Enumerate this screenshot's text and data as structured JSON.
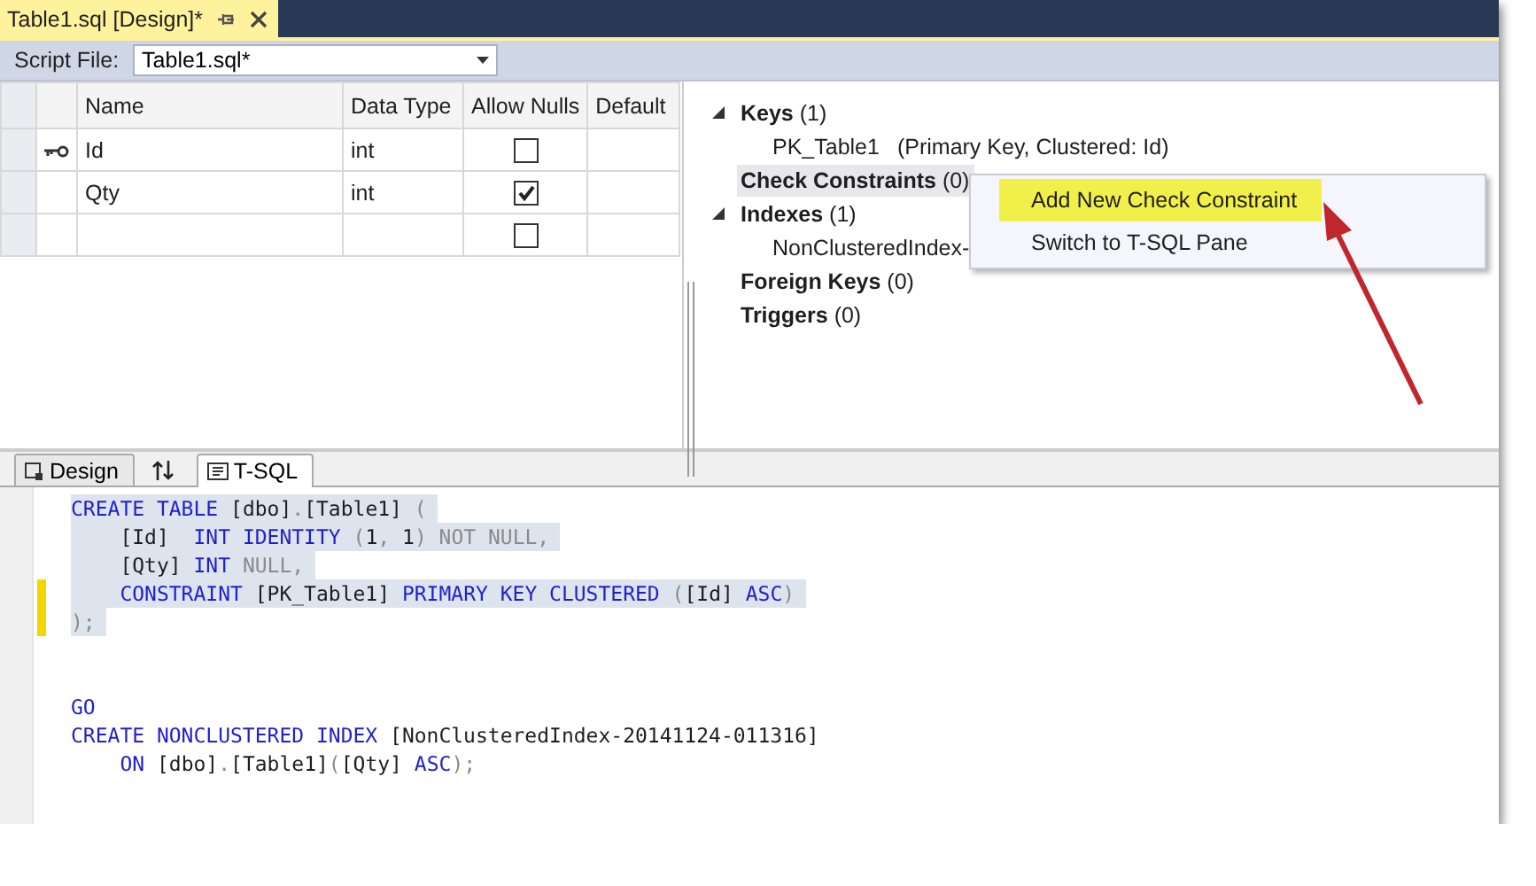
{
  "document_tab": {
    "title": "Table1.sql [Design]*",
    "selected": true
  },
  "script_file": {
    "label": "Script File:",
    "value": "Table1.sql*"
  },
  "grid": {
    "columns": [
      "Name",
      "Data Type",
      "Allow Nulls",
      "Default"
    ],
    "rows": [
      {
        "primary_key": true,
        "name": "Id",
        "data_type": "int",
        "allow_nulls": false
      },
      {
        "primary_key": false,
        "name": "Qty",
        "data_type": "int",
        "allow_nulls": true
      },
      {
        "primary_key": false,
        "allow_nulls": false
      }
    ]
  },
  "tree": [
    {
      "label": "Keys",
      "count": "(1)",
      "selected": false,
      "children": [
        {
          "name": "PK_Table1",
          "detail": "(Primary Key, Clustered: Id)"
        }
      ]
    },
    {
      "label": "Check Constraints",
      "count": "(0)",
      "selected": true
    },
    {
      "label": "Indexes",
      "count": "(1)",
      "selected": false,
      "children": [
        {
          "name": "NonClusteredIndex-"
        }
      ]
    },
    {
      "label": "Foreign Keys",
      "count": "(0)",
      "selected": false
    },
    {
      "label": "Triggers",
      "count": "(0)",
      "selected": false
    }
  ],
  "context_menu": [
    {
      "label": "Add New Check Constraint",
      "selected": true
    },
    {
      "label": "Switch to T-SQL Pane",
      "selected": false
    }
  ],
  "pane_tabs": [
    {
      "kind": "design",
      "label": "Design",
      "selected": false
    },
    {
      "kind": "swap",
      "selected": false
    },
    {
      "kind": "tsql",
      "label": "T-SQL",
      "selected": true
    }
  ],
  "code_lines": [
    {
      "selected": true,
      "modified": false,
      "tokens": [
        {
          "kind": "keyword",
          "text": "CREATE TABLE"
        },
        {
          "kind": "text",
          "text": " [dbo]"
        },
        {
          "kind": "operator",
          "text": "."
        },
        {
          "kind": "text",
          "text": "[Table1] "
        },
        {
          "kind": "operator",
          "text": "("
        }
      ]
    },
    {
      "selected": true,
      "modified": false,
      "tokens": [
        {
          "kind": "text",
          "text": "    [Id]  "
        },
        {
          "kind": "keyword",
          "text": "INT IDENTITY "
        },
        {
          "kind": "operator",
          "text": "("
        },
        {
          "kind": "text",
          "text": "1"
        },
        {
          "kind": "operator",
          "text": ", "
        },
        {
          "kind": "text",
          "text": "1"
        },
        {
          "kind": "operator",
          "text": ") NOT NULL,"
        }
      ]
    },
    {
      "selected": true,
      "modified": false,
      "tokens": [
        {
          "kind": "text",
          "text": "    [Qty] "
        },
        {
          "kind": "keyword",
          "text": "INT "
        },
        {
          "kind": "operator",
          "text": "NULL,"
        }
      ]
    },
    {
      "selected": true,
      "modified": true,
      "tokens": [
        {
          "kind": "keyword",
          "text": "    CONSTRAINT "
        },
        {
          "kind": "text",
          "text": "[PK_Table1] "
        },
        {
          "kind": "keyword",
          "text": "PRIMARY KEY CLUSTERED "
        },
        {
          "kind": "operator",
          "text": "("
        },
        {
          "kind": "text",
          "text": "[Id] "
        },
        {
          "kind": "keyword",
          "text": "ASC"
        },
        {
          "kind": "operator",
          "text": ")"
        }
      ]
    },
    {
      "selected": true,
      "modified": true,
      "tokens": [
        {
          "kind": "operator",
          "text": ");"
        }
      ]
    },
    {
      "selected": false,
      "modified": false
    },
    {
      "selected": false,
      "modified": false
    },
    {
      "selected": false,
      "modified": false,
      "tokens": [
        {
          "kind": "keyword",
          "text": "GO"
        }
      ]
    },
    {
      "selected": false,
      "modified": false,
      "tokens": [
        {
          "kind": "keyword",
          "text": "CREATE NONCLUSTERED INDEX "
        },
        {
          "kind": "text",
          "text": "[NonClusteredIndex-20141124-011316]"
        }
      ]
    },
    {
      "selected": false,
      "modified": false,
      "tokens": [
        {
          "kind": "keyword",
          "text": "    ON "
        },
        {
          "kind": "text",
          "text": "[dbo]"
        },
        {
          "kind": "operator",
          "text": "."
        },
        {
          "kind": "text",
          "text": "[Table1]"
        },
        {
          "kind": "operator",
          "text": "("
        },
        {
          "kind": "text",
          "text": "[Qty] "
        },
        {
          "kind": "keyword",
          "text": "ASC"
        },
        {
          "kind": "operator",
          "text": ");"
        }
      ]
    }
  ]
}
